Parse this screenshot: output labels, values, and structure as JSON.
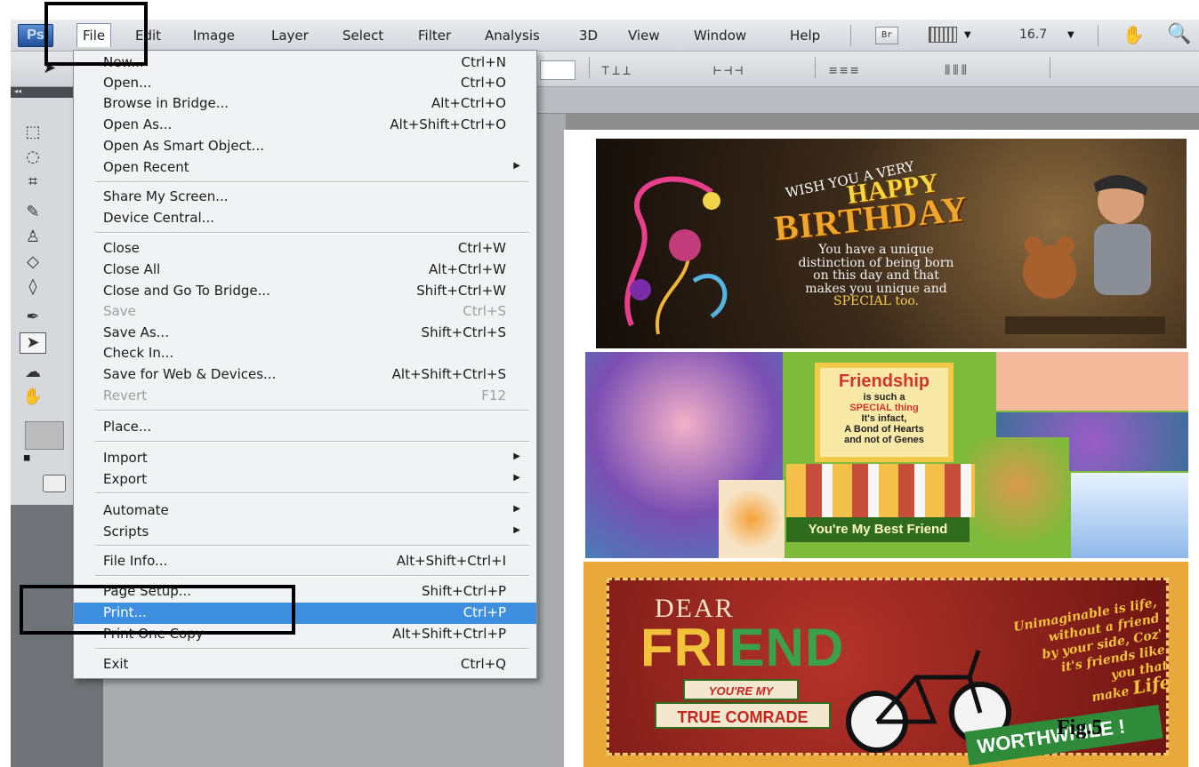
{
  "menubar": {
    "logo": "Ps",
    "items": [
      "File",
      "Edit",
      "Image",
      "Layer",
      "Select",
      "Filter",
      "Analysis",
      "3D",
      "View",
      "Window",
      "Help"
    ],
    "bridge_btn": "Br",
    "screen_mode_icon": "screen-mode-icon",
    "zoom": "16.7"
  },
  "file_menu": {
    "items": [
      {
        "label": "New...",
        "shortcut": "Ctrl+N"
      },
      {
        "label": "Open...",
        "shortcut": "Ctrl+O"
      },
      {
        "label": "Browse in Bridge...",
        "shortcut": "Alt+Ctrl+O"
      },
      {
        "label": "Open As...",
        "shortcut": "Alt+Shift+Ctrl+O"
      },
      {
        "label": "Open As Smart Object...",
        "shortcut": ""
      },
      {
        "label": "Open Recent",
        "shortcut": ""
      },
      {
        "label": "Share My Screen...",
        "shortcut": ""
      },
      {
        "label": "Device Central...",
        "shortcut": ""
      },
      {
        "label": "Close",
        "shortcut": "Ctrl+W"
      },
      {
        "label": "Close All",
        "shortcut": "Alt+Ctrl+W"
      },
      {
        "label": "Close and Go To Bridge...",
        "shortcut": "Shift+Ctrl+W"
      },
      {
        "label": "Save",
        "shortcut": "Ctrl+S"
      },
      {
        "label": "Save As...",
        "shortcut": "Shift+Ctrl+S"
      },
      {
        "label": "Check In...",
        "shortcut": ""
      },
      {
        "label": "Save for Web & Devices...",
        "shortcut": "Alt+Shift+Ctrl+S"
      },
      {
        "label": "Revert",
        "shortcut": "F12"
      },
      {
        "label": "Place...",
        "shortcut": ""
      },
      {
        "label": "Import",
        "shortcut": ""
      },
      {
        "label": "Export",
        "shortcut": ""
      },
      {
        "label": "Automate",
        "shortcut": ""
      },
      {
        "label": "Scripts",
        "shortcut": ""
      },
      {
        "label": "File Info...",
        "shortcut": "Alt+Shift+Ctrl+I"
      },
      {
        "label": "Page Setup...",
        "shortcut": "Shift+Ctrl+P"
      },
      {
        "label": "Print...",
        "shortcut": "Ctrl+P"
      },
      {
        "label": "Print One Copy",
        "shortcut": "Alt+Shift+Ctrl+P"
      },
      {
        "label": "Exit",
        "shortcut": "Ctrl+Q"
      }
    ],
    "highlight_color": "#3f8fe0"
  },
  "canvas": {
    "birthday": {
      "wish": "WISH YOU A VERY",
      "happy": "HAPPY",
      "birthday": "BIRTHDAY",
      "message": "You have a unique distinction of being born on this day and that makes you unique and",
      "special": "SPECIAL too."
    },
    "friendship": {
      "title": "Friendship",
      "line1": "is such a",
      "line2": "SPECIAL thing",
      "line3": "It's infact,",
      "line4": "A Bond of Hearts",
      "line5": "and not of Genes",
      "banner": "You're My Best Friend"
    },
    "dear_friend": {
      "dear": "DEAR",
      "friend_a": "FRI",
      "friend_b": "END",
      "youre_my": "YOU'RE MY",
      "comrade": "TRUE COMRADE",
      "quote1": "Unimaginable is life,",
      "quote2": "without a friend",
      "quote3": "by your side, Coz'",
      "quote4": "it's friends like",
      "quote5": "you that",
      "quote6a": "make ",
      "quote6b": "Life",
      "worth": "WORTHWHILE !"
    }
  },
  "figure_label": "Fig.5"
}
